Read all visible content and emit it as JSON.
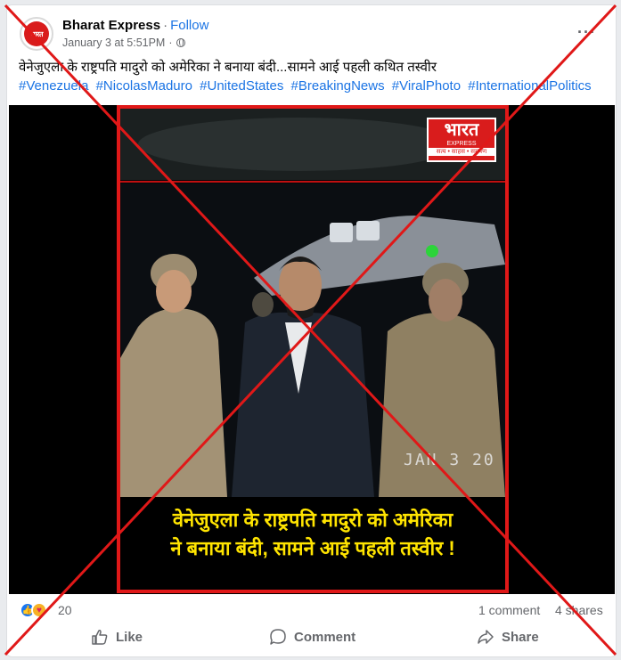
{
  "post": {
    "page_name": "Bharat Express",
    "separator": "·",
    "follow_label": "Follow",
    "timestamp": "January 3 at 5:51PM",
    "meta_separator": "·",
    "audience_icon": "globe-icon",
    "avatar_text": "भारत",
    "caption": "वेनेजुएला के राष्ट्रपति मादुरो को अमेरिका ने बनाया बंदी...सामने आई पहली कथित तस्वीर",
    "hashtags": [
      "#Venezuela",
      "#NicolasMaduro",
      "#UnitedStates",
      "#BreakingNews",
      "#ViralPhoto",
      "#InternationalPolitics"
    ]
  },
  "image": {
    "logo_main": "भारत",
    "logo_sub": "EXPRESS",
    "logo_tagline": "सत्य • साहस • समर्पण",
    "date_stamp": "JAN 3 20",
    "headline_line1": "वेनेजुएला के राष्ट्रपति मादुरो को अमेरिका",
    "headline_line2": "ने बनाया बंदी, सामने आई पहली तस्वीर !"
  },
  "engagement": {
    "reaction_count": "20",
    "comments": "1 comment",
    "shares": "4 shares"
  },
  "actions": {
    "like": "Like",
    "comment": "Comment",
    "share": "Share"
  },
  "colors": {
    "facebook_blue": "#1b74e4",
    "headline_yellow": "#ffe400",
    "brand_red": "#d91c1c",
    "cross_red": "#e01818"
  }
}
